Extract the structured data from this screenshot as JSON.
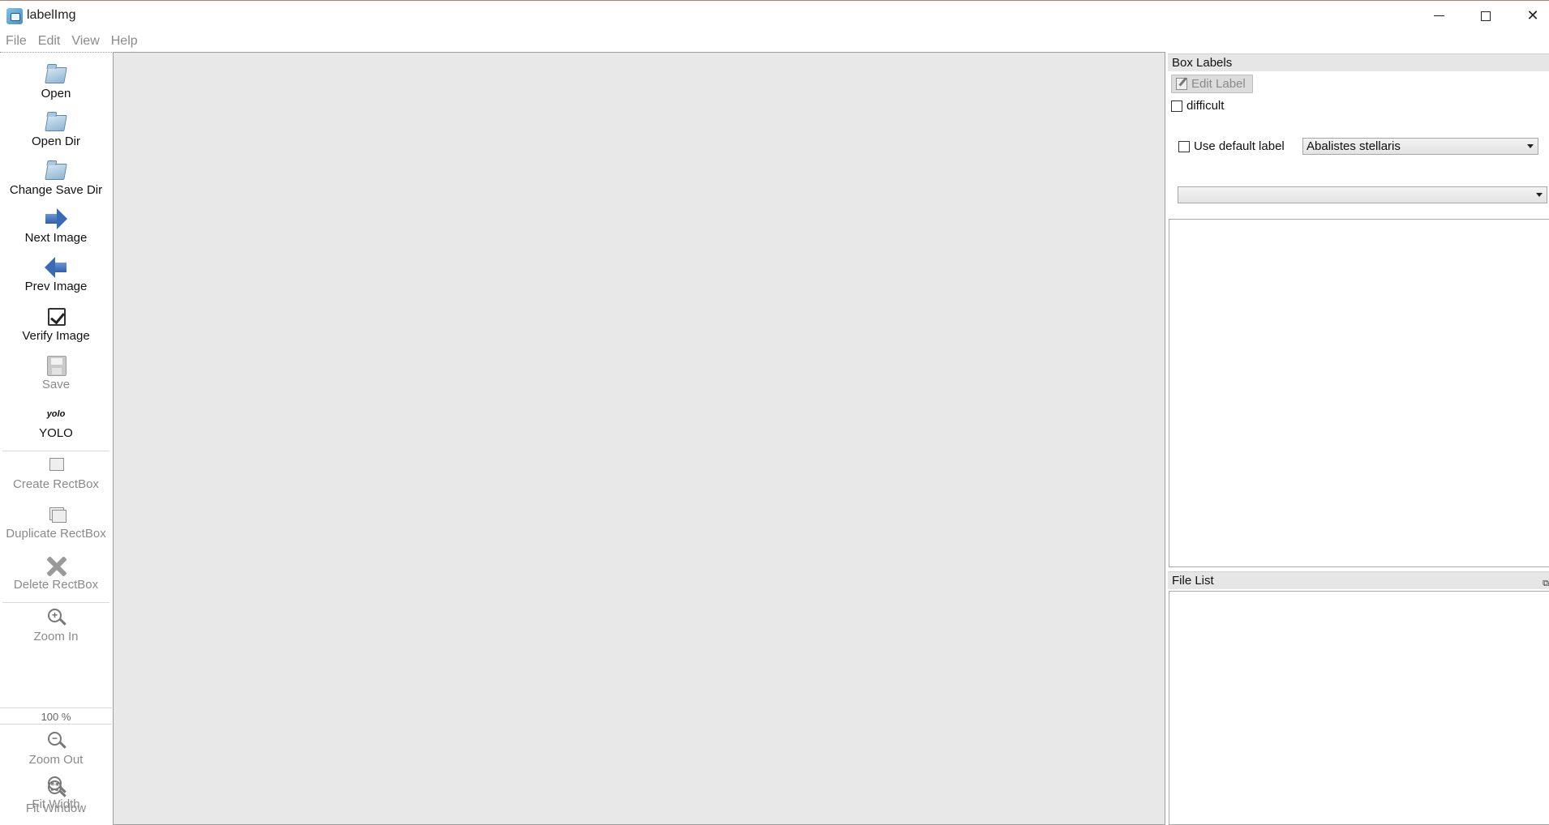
{
  "window": {
    "title": "labelImg"
  },
  "menu": [
    "File",
    "Edit",
    "View",
    "Help"
  ],
  "toolbar": {
    "open": "Open",
    "open_dir": "Open Dir",
    "change_save_dir": "Change Save Dir",
    "next_image": "Next Image",
    "prev_image": "Prev Image",
    "verify_image": "Verify Image",
    "save": "Save",
    "format_icon_text": "yolo",
    "format": "YOLO",
    "create_rectbox": "Create RectBox",
    "duplicate_rectbox": "Duplicate RectBox",
    "delete_rectbox": "Delete RectBox",
    "zoom_in": "Zoom In",
    "zoom_value": "100 %",
    "zoom_out": "Zoom Out",
    "fit_window": "Fit Window",
    "fit_width": "Fit Width"
  },
  "box_labels": {
    "title": "Box Labels",
    "edit_label": "Edit Label",
    "difficult": "difficult",
    "use_default_label": "Use default label",
    "default_label_value": "Abalistes stellaris",
    "label_filter_value": ""
  },
  "file_list": {
    "title": "File List"
  }
}
